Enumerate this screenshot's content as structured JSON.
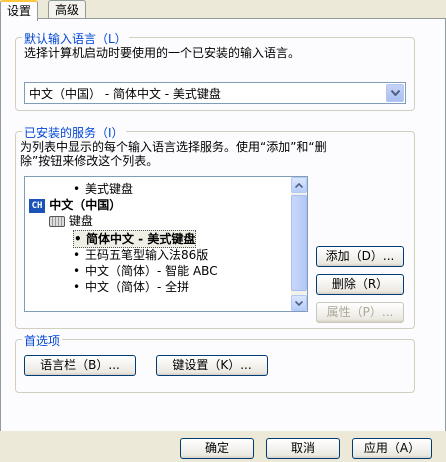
{
  "tabs": [
    {
      "label": "设置"
    },
    {
      "label": "高级"
    }
  ],
  "default_language": {
    "legend": "默认输入语言（L）",
    "description": "选择计算机启动时要使用的一个已安装的输入语言。",
    "selected": "中文（中国） - 简体中文 - 美式键盘"
  },
  "installed_services": {
    "legend": "已安装的服务（I）",
    "description_line1": "为列表中显示的每个输入语言选择服务。使用“添加”和“删",
    "description_line2": "除”按钮来修改这个列表。",
    "tree": {
      "item_top": "美式键盘",
      "language": "中文（中国）",
      "language_icon": "CH",
      "keyboard_group": "键盘",
      "items": [
        "简体中文 - 美式键盘",
        "王码五笔型输入法86版",
        "中文（简体）- 智能 ABC",
        "中文（简体）- 全拼"
      ]
    },
    "buttons": {
      "add": "添加（D）...",
      "remove": "删除（R）",
      "properties": "属性（P）..."
    }
  },
  "preferences": {
    "legend": "首选项",
    "language_bar": "语言栏（B）...",
    "key_settings": "键设置（K）..."
  },
  "footer": {
    "ok": "确定",
    "cancel": "取消",
    "apply": "应用（A）"
  }
}
